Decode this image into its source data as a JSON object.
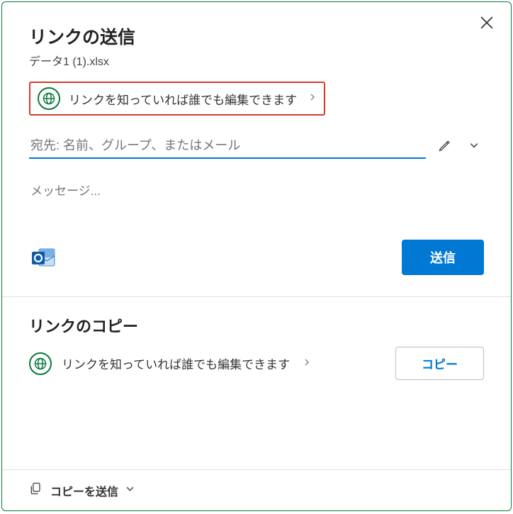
{
  "dialog": {
    "title": "リンクの送信",
    "filename": "データ1 (1).xlsx",
    "permission_text": "リンクを知っていれば誰でも編集できます",
    "recipient_placeholder": "宛先: 名前、グループ、またはメール",
    "message_placeholder": "メッセージ...",
    "send_button": "送信",
    "copy_section_title": "リンクのコピー",
    "copy_permission_text": "リンクを知っていれば誰でも編集できます",
    "copy_button": "コピー",
    "footer_text": "コピーを送信"
  }
}
